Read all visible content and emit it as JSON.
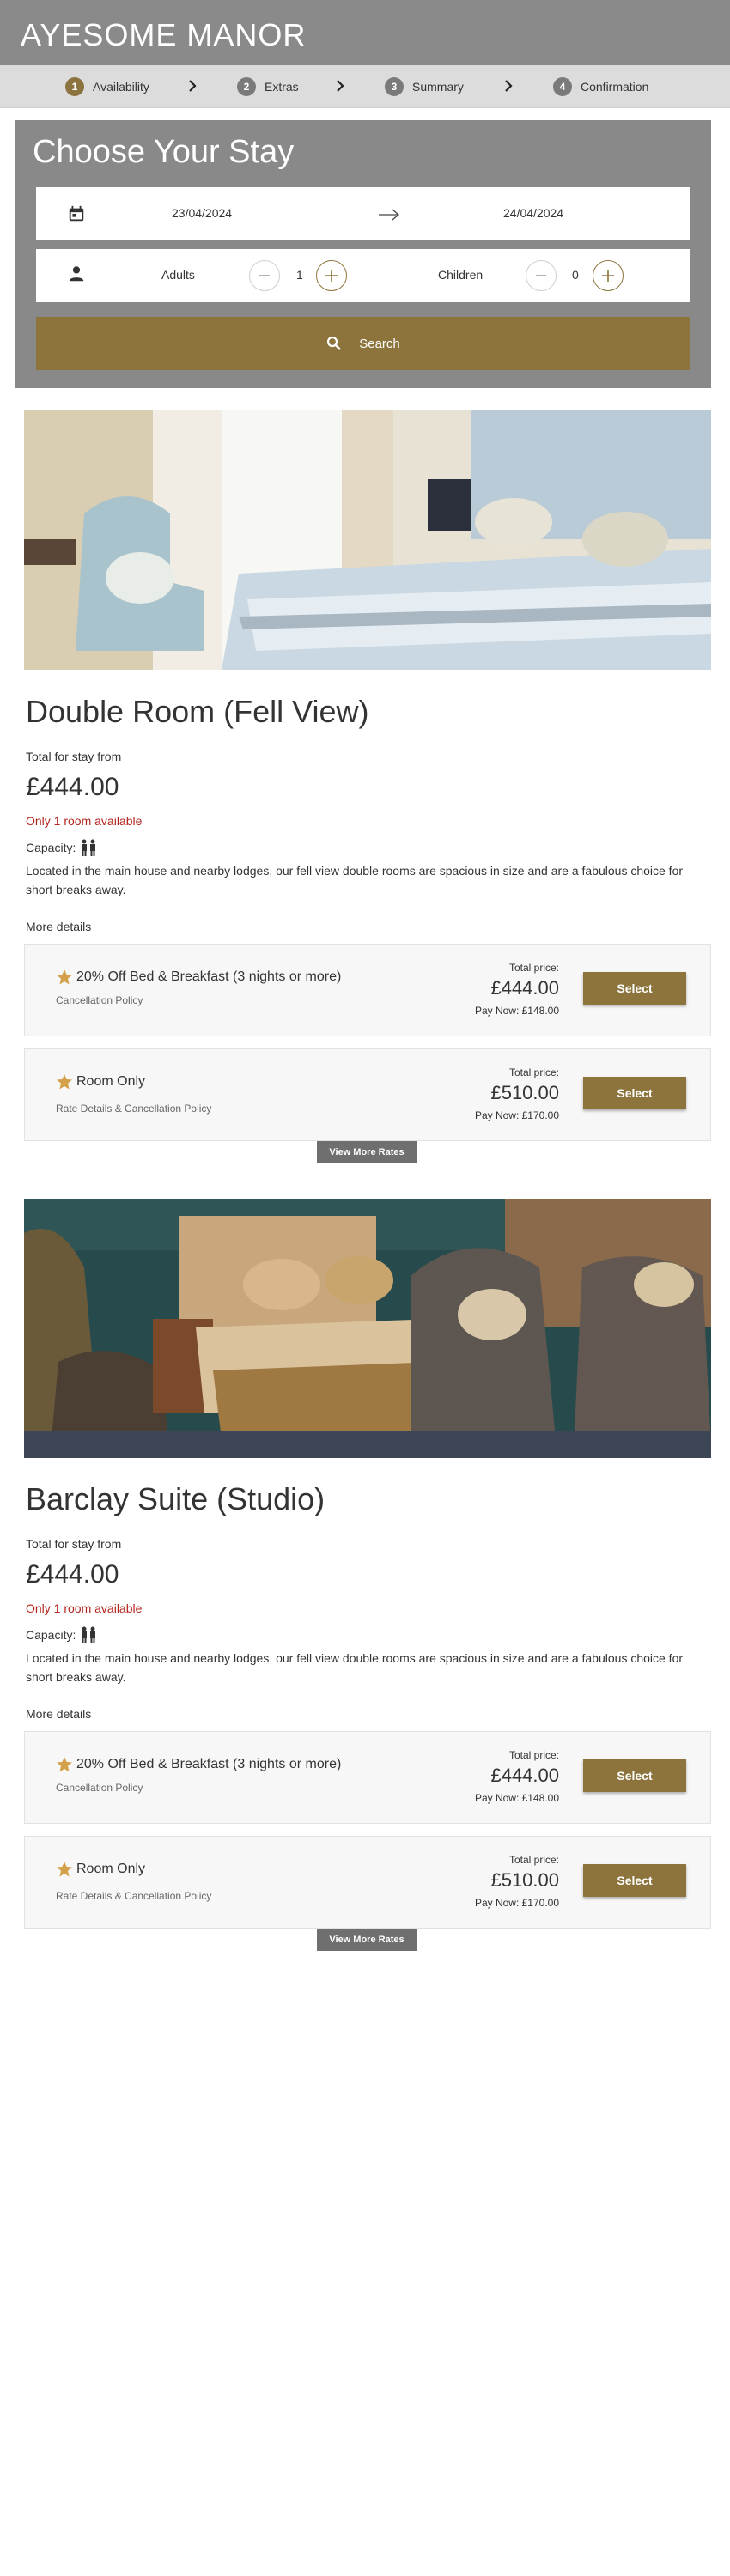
{
  "header": {
    "brand": "AYESOME MANOR"
  },
  "steps": [
    {
      "num": "1",
      "label": "Availability",
      "active": true
    },
    {
      "num": "2",
      "label": "Extras",
      "active": false
    },
    {
      "num": "3",
      "label": "Summary",
      "active": false
    },
    {
      "num": "4",
      "label": "Confirmation",
      "active": false
    }
  ],
  "search": {
    "title": "Choose Your Stay",
    "check_in": "23/04/2024",
    "check_out": "24/04/2024",
    "adults_label": "Adults",
    "adults_value": "1",
    "children_label": "Children",
    "children_value": "0",
    "button_label": "Search"
  },
  "rooms": [
    {
      "name": "Double Room (Fell View)",
      "total_label": "Total for stay from",
      "price": "£444.00",
      "availability": "Only 1 room available",
      "capacity_label": "Capacity:",
      "description": "Located in the main house and nearby lodges, our fell view double rooms are spacious in size and are a fabulous choice for short breaks away.",
      "more_details": "More details",
      "rates": [
        {
          "name": "20% Off Bed & Breakfast (3 nights or more)",
          "sub": "Cancellation Policy",
          "total_label": "Total price:",
          "price": "£444.00",
          "pay_now": "Pay Now: £148.00",
          "select": "Select"
        },
        {
          "name": "Room Only",
          "sub": "Rate Details & Cancellation Policy",
          "total_label": "Total price:",
          "price": "£510.00",
          "pay_now": "Pay Now: £170.00",
          "select": "Select"
        }
      ],
      "view_more": "View More Rates"
    },
    {
      "name": "Barclay Suite (Studio)",
      "total_label": "Total for stay from",
      "price": "£444.00",
      "availability": "Only 1 room available",
      "capacity_label": "Capacity:",
      "description": "Located in the main house and nearby lodges, our fell view double rooms are spacious in size and are a fabulous choice for short breaks away.",
      "more_details": "More details",
      "rates": [
        {
          "name": "20% Off Bed & Breakfast (3 nights or more)",
          "sub": "Cancellation Policy",
          "total_label": "Total price:",
          "price": "£444.00",
          "pay_now": "Pay Now: £148.00",
          "select": "Select"
        },
        {
          "name": "Room Only",
          "sub": "Rate Details & Cancellation Policy",
          "total_label": "Total price:",
          "price": "£510.00",
          "pay_now": "Pay Now: £170.00",
          "select": "Select"
        }
      ],
      "view_more": "View More Rates"
    }
  ],
  "colors": {
    "accent": "#8c743c",
    "header": "#8a8a8a",
    "steps_bg": "#dcdcdc",
    "availability": "#b3261e",
    "star": "#d4a04a"
  },
  "icons": [
    "calendar-icon",
    "arrow-right-icon",
    "person-icon",
    "minus-icon",
    "plus-icon",
    "search-icon",
    "star-icon",
    "capacity-people-icon",
    "chevron-right-icon"
  ]
}
